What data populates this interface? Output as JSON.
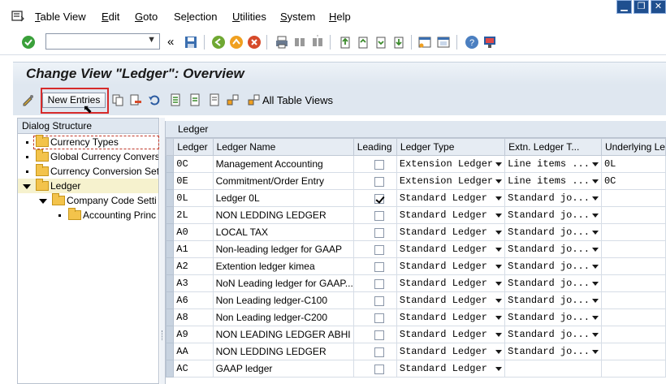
{
  "menubar": {
    "items": [
      {
        "pre": "",
        "ul": "T",
        "post": "able View"
      },
      {
        "pre": "",
        "ul": "E",
        "post": "dit"
      },
      {
        "pre": "",
        "ul": "G",
        "post": "oto"
      },
      {
        "pre": "Se",
        "ul": "l",
        "post": "ection"
      },
      {
        "pre": "",
        "ul": "U",
        "post": "tilities"
      },
      {
        "pre": "",
        "ul": "S",
        "post": "ystem"
      },
      {
        "pre": "",
        "ul": "H",
        "post": "elp"
      }
    ]
  },
  "window_controls": {
    "minimize": "▁",
    "restore": "❐",
    "close": "✕"
  },
  "toolbar": {
    "command_field_value": "",
    "nav_back_glyph": "«"
  },
  "title": "Change View \"Ledger\": Overview",
  "app_toolbar": {
    "new_entries_label": "New Entries",
    "all_table_views_label": "All Table Views"
  },
  "dialog_structure": {
    "heading": "Dialog Structure",
    "items": [
      {
        "label": "Currency Types"
      },
      {
        "label": "Global Currency Conversi"
      },
      {
        "label": "Currency Conversion Set"
      },
      {
        "label": "Ledger"
      },
      {
        "label": "Company Code Setti"
      },
      {
        "label": "Accounting Princ"
      }
    ]
  },
  "table": {
    "heading": "Ledger",
    "columns": [
      "Ledger",
      "Ledger Name",
      "Leading",
      "Ledger Type",
      "Extn. Ledger T...",
      "Underlying Le"
    ],
    "rows": [
      {
        "ledger": "0C",
        "name": "Management Accounting",
        "leading": false,
        "type": "Extension Ledger",
        "extn": "Line items ...",
        "underlying": "0L"
      },
      {
        "ledger": "0E",
        "name": "Commitment/Order Entry",
        "leading": false,
        "type": "Extension Ledger",
        "extn": "Line items ...",
        "underlying": "0C"
      },
      {
        "ledger": "0L",
        "name": "Ledger 0L",
        "leading": true,
        "type": "Standard Ledger",
        "extn": "Standard jo...",
        "underlying": ""
      },
      {
        "ledger": "2L",
        "name": "NON LEDDING LEDGER",
        "leading": false,
        "type": "Standard Ledger",
        "extn": "Standard jo...",
        "underlying": ""
      },
      {
        "ledger": "A0",
        "name": "LOCAL TAX",
        "leading": false,
        "type": "Standard Ledger",
        "extn": "Standard jo...",
        "underlying": ""
      },
      {
        "ledger": "A1",
        "name": "Non-leading ledger for GAAP",
        "leading": false,
        "type": "Standard Ledger",
        "extn": "Standard jo...",
        "underlying": ""
      },
      {
        "ledger": "A2",
        "name": "Extention ledger kimea",
        "leading": false,
        "type": "Standard Ledger",
        "extn": "Standard jo...",
        "underlying": ""
      },
      {
        "ledger": "A3",
        "name": "NoN Leading ledger for GAAP...",
        "leading": false,
        "type": "Standard Ledger",
        "extn": "Standard jo...",
        "underlying": ""
      },
      {
        "ledger": "A6",
        "name": "Non Leading ledger-C100",
        "leading": false,
        "type": "Standard Ledger",
        "extn": "Standard jo...",
        "underlying": ""
      },
      {
        "ledger": "A8",
        "name": "Non Leading ledger-C200",
        "leading": false,
        "type": "Standard Ledger",
        "extn": "Standard jo...",
        "underlying": ""
      },
      {
        "ledger": "A9",
        "name": "NON LEADING LEDGER ABHI",
        "leading": false,
        "type": "Standard Ledger",
        "extn": "Standard jo...",
        "underlying": ""
      },
      {
        "ledger": "AA",
        "name": "NON LEDDING LEDGER",
        "leading": false,
        "type": "Standard Ledger",
        "extn": "Standard jo...",
        "underlying": ""
      },
      {
        "ledger": "AC",
        "name": "GAAP ledger",
        "leading": false,
        "type": "Standard Ledger",
        "extn": "",
        "underlying": ""
      }
    ]
  },
  "colors": {
    "accent_red": "#d62a2a",
    "panel_blue": "#dfe7f0",
    "folder": "#f3c34b"
  }
}
